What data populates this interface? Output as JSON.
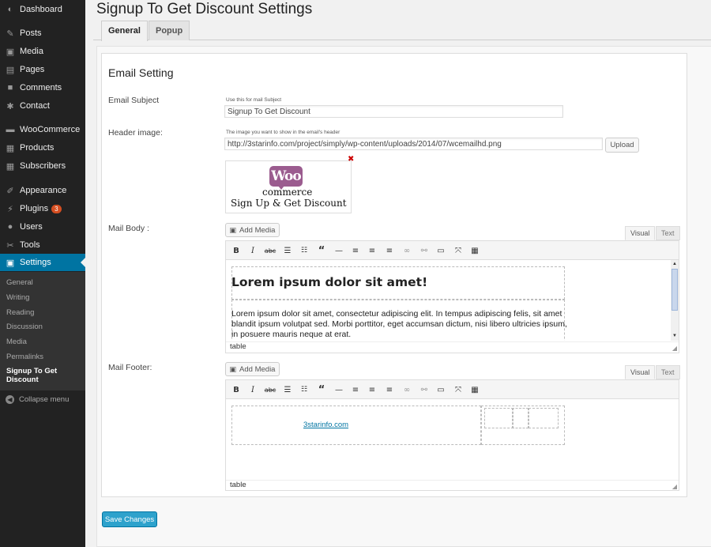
{
  "sidebar": {
    "items": [
      {
        "label": "Dashboard",
        "icon": "dashboard-icon"
      },
      {
        "label": "Posts",
        "icon": "pin-icon"
      },
      {
        "label": "Media",
        "icon": "media-icon"
      },
      {
        "label": "Pages",
        "icon": "pages-icon"
      },
      {
        "label": "Comments",
        "icon": "comment-icon"
      },
      {
        "label": "Contact",
        "icon": "gear-icon"
      },
      {
        "label": "WooCommerce",
        "icon": "woocommerce-icon"
      },
      {
        "label": "Products",
        "icon": "products-icon"
      },
      {
        "label": "Subscribers",
        "icon": "subscribers-icon"
      },
      {
        "label": "Appearance",
        "icon": "brush-icon"
      },
      {
        "label": "Plugins",
        "icon": "plug-icon",
        "badge": "3"
      },
      {
        "label": "Users",
        "icon": "user-icon"
      },
      {
        "label": "Tools",
        "icon": "wrench-icon"
      },
      {
        "label": "Settings",
        "icon": "settings-icon"
      }
    ],
    "submenu": [
      "General",
      "Writing",
      "Reading",
      "Discussion",
      "Media",
      "Permalinks",
      "Signup To Get Discount"
    ],
    "collapse_label": "Collapse menu"
  },
  "header": {
    "title": "Signup To Get Discount Settings",
    "tabs": [
      "General",
      "Popup"
    ]
  },
  "form": {
    "section_title": "Email Setting",
    "email_subject": {
      "label": "Email Subject",
      "hint": "Use this for mail Subject",
      "value": "Signup To Get Discount"
    },
    "header_image": {
      "label": "Header image:",
      "hint": "The image you want to show in the email's header",
      "value": "http://3starinfo.com/project/simply/wp-content/uploads/2014/07/wcemailhd.png",
      "upload_label": "Upload",
      "preview": {
        "logo": "Woo",
        "line1": "commerce",
        "line2": "Sign Up & Get Discount"
      },
      "remove_icon": "✖"
    },
    "mail_body": {
      "label": "Mail Body :",
      "add_media": "Add Media",
      "tab_visual": "Visual",
      "tab_text": "Text",
      "heading": "Lorem ipsum dolor sit amet!",
      "paragraph": "Lorem ipsum dolor sit amet, consectetur adipiscing elit. In tempus adipiscing felis, sit amet blandit ipsum volutpat sed. Morbi porttitor, eget accumsan dictum, nisi libero ultricies ipsum, in posuere mauris neque at erat.",
      "status": "table"
    },
    "mail_footer": {
      "label": "Mail Footer:",
      "add_media": "Add Media",
      "tab_visual": "Visual",
      "tab_text": "Text",
      "link": "3starinfo.com",
      "status": "table"
    },
    "toolbar_icons": [
      "bold-icon",
      "italic-icon",
      "strikethrough-icon",
      "bullet-list-icon",
      "numbered-list-icon",
      "blockquote-icon",
      "horizontal-rule-icon",
      "align-left-icon",
      "align-center-icon",
      "align-right-icon",
      "link-icon",
      "unlink-icon",
      "read-more-icon",
      "fullscreen-icon",
      "toolbar-toggle-icon"
    ],
    "save_label": "Save Changes"
  },
  "colors": {
    "sidebar_bg": "#222222",
    "active_menu": "#0074a2",
    "save_button": "#2ea2cc",
    "badge": "#d54e21",
    "woo_purple": "#9b5c8f"
  }
}
